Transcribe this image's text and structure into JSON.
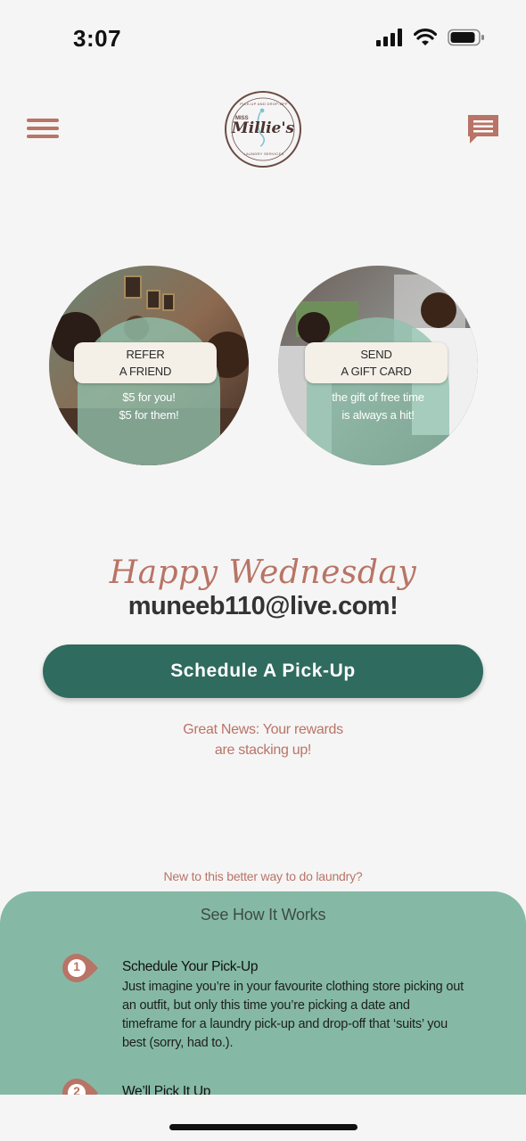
{
  "status_bar": {
    "time": "3:07"
  },
  "header": {
    "logo_top_text": "PICK-UP AND DROP-OFF",
    "logo_small": "MISS",
    "logo_name": "Millie's",
    "logo_bottom_text": "LAUNDRY SERVICES"
  },
  "promos": [
    {
      "line1": "REFER",
      "line2": "A FRIEND",
      "sub1": "$5 for you!",
      "sub2": "$5 for them!"
    },
    {
      "line1": "SEND",
      "line2": "A GIFT CARD",
      "sub1": "the gift of free time",
      "sub2": "is always a hit!"
    }
  ],
  "greeting": {
    "script": "Happy Wednesday",
    "email": "muneeb110@live.com!"
  },
  "schedule_button": "Schedule A Pick-Up",
  "rewards": {
    "line1": "Great News: Your rewards",
    "line2": "are stacking up!"
  },
  "new_prompt": "New to this better way to do laundry?",
  "how_it_works": {
    "title": "See How It Works",
    "steps": [
      {
        "number": "1",
        "title": "Schedule Your Pick-Up",
        "desc": "Just imagine you’re in your favourite clothing store picking out an outfit, but only this time you’re picking a date and timeframe for a laundry pick-up and drop-off that ‘suits’ you best (sorry, had to.)."
      },
      {
        "number": "2",
        "title": "We’ll Pick It Up"
      }
    ]
  },
  "colors": {
    "accent": "#b87466",
    "primary": "#2f6b5e",
    "panel": "#85b9a6",
    "background": "#f6f5f5"
  }
}
